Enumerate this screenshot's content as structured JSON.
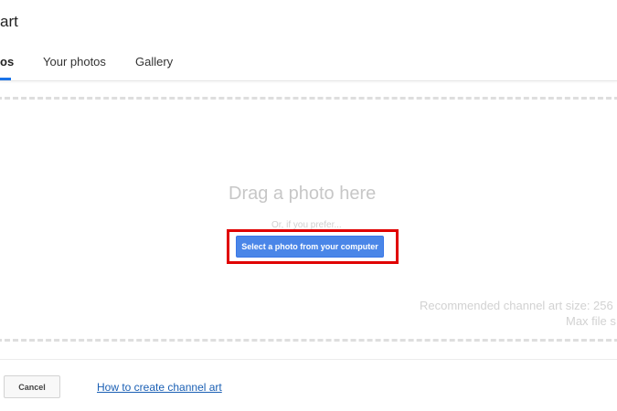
{
  "dialog": {
    "title": "art"
  },
  "tabs": [
    {
      "label": "os",
      "active": true
    },
    {
      "label": "Your photos",
      "active": false
    },
    {
      "label": "Gallery",
      "active": false
    }
  ],
  "upload": {
    "drag_text": "Drag a photo here",
    "prefer_text": "Or, if you prefer...",
    "select_button_label": "Select a photo from your computer",
    "recommended_text": "Recommended channel art size: 256",
    "max_file_text": "Max file s"
  },
  "footer": {
    "cancel_label": "Cancel",
    "help_link_text": "How to create channel art"
  },
  "colors": {
    "accent": "#4a86e8",
    "highlight": "#e00000",
    "link": "#1a5fb4"
  }
}
